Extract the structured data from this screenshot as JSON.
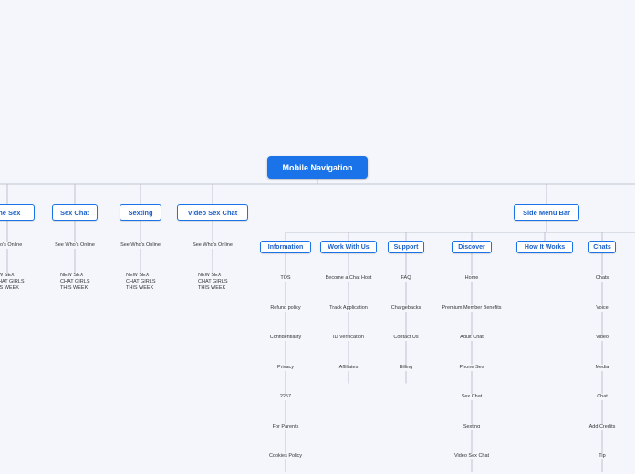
{
  "root": {
    "label": "Mobile Navigation"
  },
  "colors": {
    "accent": "#1a73e8",
    "line": "#b0b7c3",
    "background": "#f4f6fc"
  },
  "left_branches": [
    {
      "label": "one Sex",
      "leaves": [
        "Who's Online",
        "W SEX\nHAT GIRLS\nIS WEEK"
      ]
    },
    {
      "label": "Sex Chat",
      "leaves": [
        "See Who's Online",
        "NEW SEX\nCHAT GIRLS\nTHIS WEEK"
      ]
    },
    {
      "label": "Sexting",
      "leaves": [
        "See Who's Online",
        "NEW SEX\nCHAT GIRLS\nTHIS WEEK"
      ]
    },
    {
      "label": "Video Sex Chat",
      "leaves": [
        "See Who's Online",
        "NEW SEX\nCHAT GIRLS\nTHIS WEEK"
      ]
    }
  ],
  "side_menu": {
    "label": "Side Menu Bar",
    "groups": [
      {
        "label": "Information",
        "leaves": [
          "TOS",
          "Refund policy",
          "Confidentiality",
          "Privacy",
          "2257",
          "For Parents",
          "Cookies Policy"
        ]
      },
      {
        "label": "Work With Us",
        "leaves": [
          "Become a Chat Host",
          "Track Application",
          "ID Verification",
          "Affiliates"
        ]
      },
      {
        "label": "Support",
        "leaves": [
          "FAQ",
          "Chargebacks",
          "Contact Us",
          "Billing"
        ]
      },
      {
        "label": "Discover",
        "leaves": [
          "Home",
          "Premium Member Benefits",
          "Adult Chat",
          "Phone Sex",
          "Sex Chat",
          "Sexting",
          "Video Sex Chat"
        ]
      },
      {
        "label": "How It Works",
        "leaves": []
      },
      {
        "label": "Chats",
        "leaves": [
          "Chats",
          "Voice",
          "Video",
          "Media",
          "Chat",
          "Add Credits",
          "Tip"
        ]
      }
    ]
  }
}
